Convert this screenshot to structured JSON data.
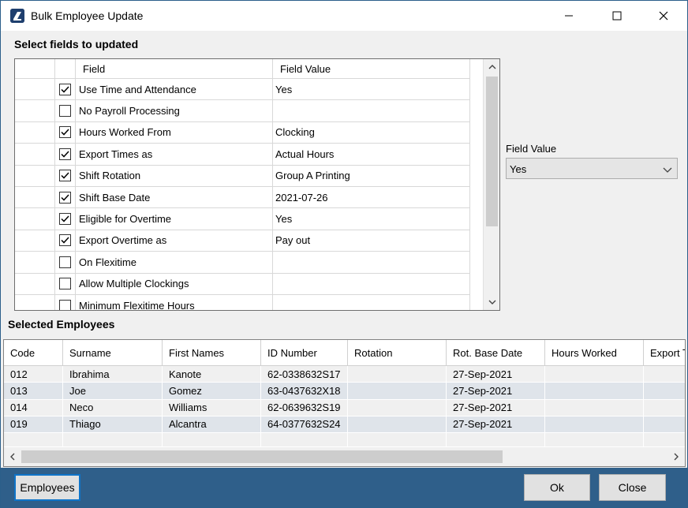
{
  "window": {
    "title": "Bulk Employee Update"
  },
  "fields_section": {
    "label": "Select fields to updated",
    "columns": {
      "field": "Field",
      "value": "Field Value"
    },
    "rows": [
      {
        "checked": true,
        "field": "Use Time and Attendance",
        "value": "Yes"
      },
      {
        "checked": false,
        "field": "No Payroll Processing",
        "value": ""
      },
      {
        "checked": true,
        "field": "Hours Worked From",
        "value": "Clocking"
      },
      {
        "checked": true,
        "field": "Export Times as",
        "value": "Actual Hours"
      },
      {
        "checked": true,
        "field": "Shift Rotation",
        "value": "Group A Printing"
      },
      {
        "checked": true,
        "field": "Shift Base Date",
        "value": "2021-07-26"
      },
      {
        "checked": true,
        "field": "Eligible for Overtime",
        "value": "Yes"
      },
      {
        "checked": true,
        "field": "Export Overtime as",
        "value": "Pay out"
      },
      {
        "checked": false,
        "field": "On Flexitime",
        "value": ""
      },
      {
        "checked": false,
        "field": "Allow Multiple Clockings",
        "value": ""
      },
      {
        "checked": false,
        "field": "Minimum Flexitime Hours",
        "value": ""
      }
    ]
  },
  "field_value_panel": {
    "label": "Field Value",
    "selected": "Yes"
  },
  "employees_section": {
    "label": "Selected Employees",
    "columns": {
      "code": "Code",
      "surname": "Surname",
      "first_names": "First Names",
      "id_number": "ID Number",
      "rotation": "Rotation",
      "rot_base_date": "Rot. Base Date",
      "hours_worked": "Hours Worked",
      "export": "Export T"
    },
    "rows": [
      {
        "code": "012",
        "surname": "Ibrahima",
        "first_names": "Kanote",
        "id_number": "62-0338632S17",
        "rotation": "",
        "rot_base_date": "27-Sep-2021",
        "hours_worked": "",
        "export": ""
      },
      {
        "code": "013",
        "surname": "Joe",
        "first_names": "Gomez",
        "id_number": "63-0437632X18",
        "rotation": "",
        "rot_base_date": "27-Sep-2021",
        "hours_worked": "",
        "export": ""
      },
      {
        "code": "014",
        "surname": "Neco",
        "first_names": "Williams",
        "id_number": "62-0639632S19",
        "rotation": "",
        "rot_base_date": "27-Sep-2021",
        "hours_worked": "",
        "export": ""
      },
      {
        "code": "019",
        "surname": "Thiago",
        "first_names": "Alcantra",
        "id_number": "64-0377632S24",
        "rotation": "",
        "rot_base_date": "27-Sep-2021",
        "hours_worked": "",
        "export": ""
      }
    ]
  },
  "buttons": {
    "employees": "Employees",
    "ok": "Ok",
    "close": "Close"
  }
}
